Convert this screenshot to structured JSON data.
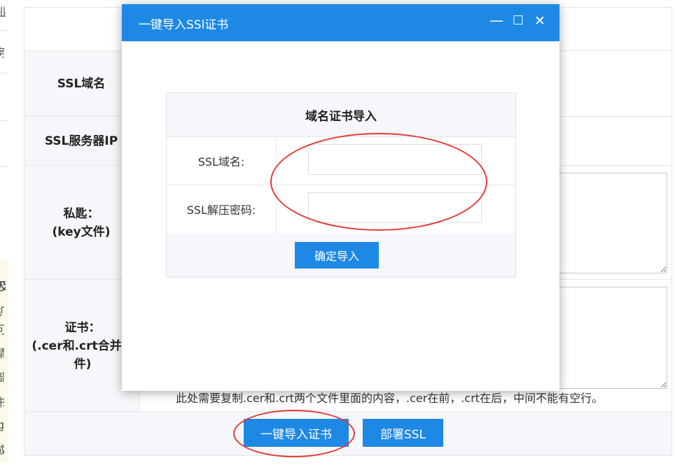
{
  "background_form": {
    "rows": [
      {
        "label": "SSL域名"
      },
      {
        "label": "SSL服务器IP"
      },
      {
        "label": "私匙：\n(key文件)"
      },
      {
        "label": "证书：\n(.cer和.crt合并文件)"
      }
    ],
    "note": "此处需要复制.cer和.crt两个文件里面的内容，.cer在前，.crt在后，中间不能有空行。",
    "buttons": {
      "import": "一键导入证书",
      "deploy": "部署SSL"
    }
  },
  "left_strip": {
    "fragments": [
      "业",
      "务",
      "及",
      "机",
      "可",
      "请",
      "部",
      "书",
      "g",
      "成"
    ]
  },
  "modal": {
    "title": "一键导入SSl证书",
    "controls": {
      "minimize": "—",
      "maximize": "☐",
      "close": "✕"
    },
    "card": {
      "heading": "域名证书导入",
      "fields": [
        {
          "label": "SSL域名:",
          "value": ""
        },
        {
          "label": "SSL解压密码:",
          "value": ""
        }
      ],
      "confirm": "确定导入"
    }
  },
  "colors": {
    "accent": "#1e88e5",
    "label_bg": "#f5f7fa",
    "annotation": "#e53935"
  }
}
